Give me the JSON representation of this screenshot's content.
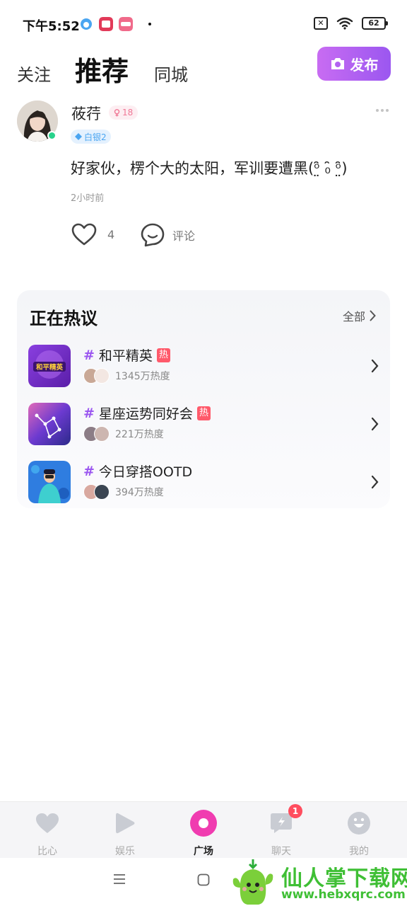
{
  "status_bar": {
    "time": "下午5:52",
    "battery": "62",
    "sim_icon": "✕"
  },
  "header": {
    "tabs": [
      {
        "label": "关注",
        "active": false
      },
      {
        "label": "推荐",
        "active": true
      },
      {
        "label": "同城",
        "active": false
      }
    ],
    "publish_label": "发布"
  },
  "post": {
    "username": "莜荇",
    "gender_age": "18",
    "level": "白银2",
    "content": "好家伙，楞个大的太阳，军训要遭黑(ᵒ̤̑ ₀̑ ᵒ̤̑)",
    "time": "2小时前",
    "likes": "4",
    "comment_label": "评论"
  },
  "hot": {
    "title": "正在热议",
    "all_label": "全部",
    "topics": [
      {
        "name": "和平精英",
        "hot_tag": "热",
        "heat": "1345万热度",
        "thumb_text": "和平精英"
      },
      {
        "name": "星座运势同好会",
        "hot_tag": "热",
        "heat": "221万热度"
      },
      {
        "name": "今日穿搭OOTD",
        "heat": "394万热度"
      }
    ]
  },
  "bottom_nav": {
    "items": [
      {
        "label": "比心",
        "icon": "heart-icon"
      },
      {
        "label": "娱乐",
        "icon": "play-icon"
      },
      {
        "label": "广场",
        "icon": "square-circle-icon",
        "active": true
      },
      {
        "label": "聊天",
        "icon": "chat-icon",
        "badge": "1"
      },
      {
        "label": "我的",
        "icon": "profile-icon"
      }
    ]
  },
  "watermark": {
    "text": "仙人掌下载网",
    "url": "www.hebxqrc.com"
  },
  "colors": {
    "accent_purple": "#9b57f0",
    "active_pink": "#f03cb0",
    "hot_red": "#ff5a6b",
    "online_green": "#28d28b"
  }
}
